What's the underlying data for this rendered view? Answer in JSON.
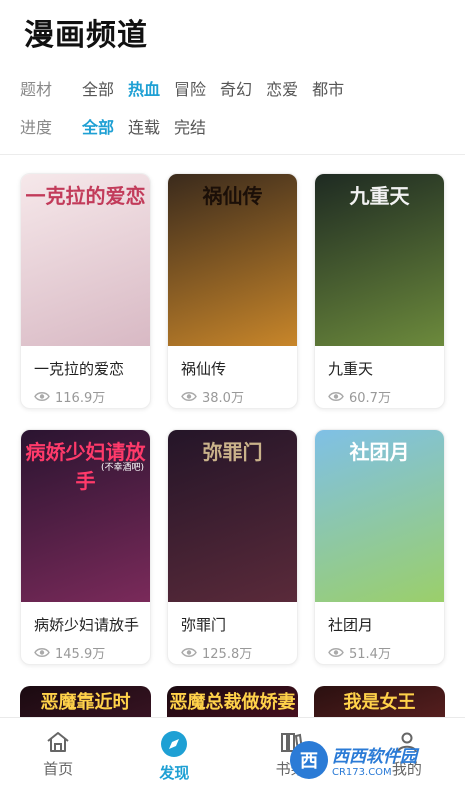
{
  "page": {
    "title": "漫画频道"
  },
  "filters": {
    "genre": {
      "label": "题材",
      "options": [
        "全部",
        "热血",
        "冒险",
        "奇幻",
        "恋爱",
        "都市"
      ],
      "active_index": 1
    },
    "progress": {
      "label": "进度",
      "options": [
        "全部",
        "连载",
        "完结"
      ],
      "active_index": 0
    }
  },
  "comics": [
    {
      "title": "一克拉的爱恋",
      "views": "116.9万",
      "cover_text": "一克拉的爱恋",
      "cover_colors": [
        "#f6e8ea",
        "#d8b9c4"
      ],
      "cover_text_color": "#c23b5a"
    },
    {
      "title": "祸仙传",
      "views": "38.0万",
      "cover_text": "祸仙传",
      "cover_colors": [
        "#3a2a1c",
        "#c8862a"
      ],
      "cover_text_color": "#1b0f08"
    },
    {
      "title": "九重天",
      "views": "60.7万",
      "cover_text": "九重天",
      "cover_colors": [
        "#1e2a22",
        "#6c8a3c"
      ],
      "cover_text_color": "#f2f2f2"
    },
    {
      "title": "病娇少妇请放手",
      "views": "145.9万",
      "cover_text": "病娇少妇请放手",
      "cover_sub": "(不幸酒吧)",
      "cover_colors": [
        "#2a1430",
        "#7a2a5a"
      ],
      "cover_text_color": "#ff3a6a"
    },
    {
      "title": "弥罪门",
      "views": "125.8万",
      "cover_text": "弥罪门",
      "cover_colors": [
        "#241528",
        "#5a2a3a"
      ],
      "cover_text_color": "#c9b28a"
    },
    {
      "title": "社团月",
      "views": "51.4万",
      "cover_text": "社团月",
      "cover_colors": [
        "#7fc0e6",
        "#9bcf6a"
      ],
      "cover_text_color": "#ffffff"
    }
  ],
  "partial_covers": [
    {
      "cover_text": "恶魔靠近时",
      "cover_colors": [
        "#1a0a10",
        "#3a1424"
      ],
      "cover_text_color": "#ffd24a"
    },
    {
      "cover_text": "恶魔总裁做娇妻",
      "cover_colors": [
        "#1a0a10",
        "#4a1020"
      ],
      "cover_text_color": "#ffd24a"
    },
    {
      "cover_text": "我是女王",
      "cover_colors": [
        "#2a1010",
        "#5a2020"
      ],
      "cover_text_color": "#ffd24a"
    }
  ],
  "bottom_nav": [
    {
      "label": "首页",
      "icon": "home-icon",
      "active": false
    },
    {
      "label": "发现",
      "icon": "compass-icon",
      "active": true
    },
    {
      "label": "书架",
      "icon": "bookshelf-icon",
      "active": false
    },
    {
      "label": "我的",
      "icon": "user-icon",
      "active": false
    }
  ],
  "watermark": {
    "logo_text": "西",
    "main": "西西软件园",
    "url": "CR173.COM"
  },
  "colors": {
    "accent": "#1ea0d4"
  }
}
